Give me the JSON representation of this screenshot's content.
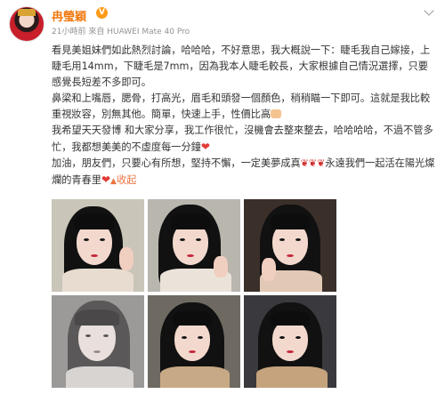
{
  "user": {
    "name": "冉瑩穎",
    "vip_badge": "V"
  },
  "meta": {
    "time": "21小時前",
    "source_prefix": "來自",
    "device": "HUAWEI Mate 40 Pro"
  },
  "post": {
    "paragraph1": "看見美姐妹們如此熱烈討論，哈哈哈，不好意思，我大概說一下：睫毛我自己嫁接，上睫毛用14mm，下睫毛是7mm，因為我本人睫毛較長，大家根據自己情況選擇，只要感覺長短差不多即可。",
    "paragraph2": "鼻梁和上嘴唇，腮骨，打高光，眉毛和頭發一個顏色，稍稍瞄一下即可。這就是我比較重視妝容，別無其他。簡單，快速上手，性價比高",
    "paragraph3": "我希望天天發博 和大家分享，我工作很忙，沒機會去整來整去，哈哈哈哈，不過不管多忙，我都想美美的不虛度每一分鐘",
    "paragraph4a": "加油，朋友們，只要心有所想，堅持不懈，一定美夢成真",
    "paragraph4b": "永遠我們一起活在陽光燦爛的青春里",
    "collapse_label": "收起"
  },
  "icons": {
    "thumb": "thumbs-up-icon",
    "heart": "heart-icon",
    "rose": "rose-icon",
    "expand": "chevron-down-icon"
  },
  "colors": {
    "username": "#f0780e",
    "link": "#eb7340",
    "meta": "#939393",
    "text": "#333333"
  }
}
